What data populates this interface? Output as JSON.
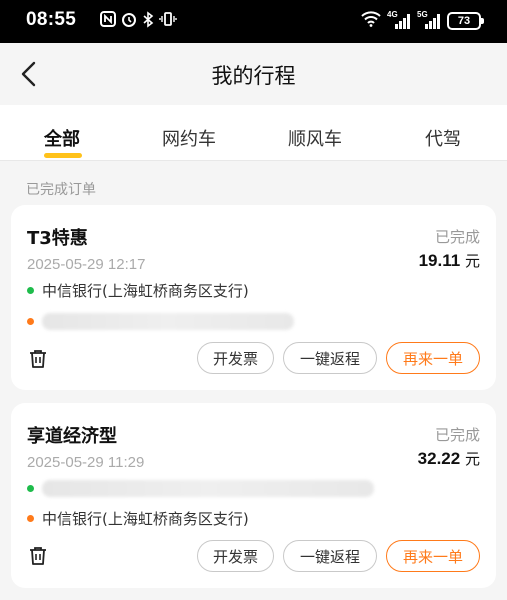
{
  "status_bar": {
    "time": "08:55",
    "battery": "73",
    "network_1": "4G",
    "network_2": "5G"
  },
  "header": {
    "title": "我的行程"
  },
  "tabs": [
    {
      "label": "全部",
      "active": true
    },
    {
      "label": "网约车",
      "active": false
    },
    {
      "label": "顺风车",
      "active": false
    },
    {
      "label": "代驾",
      "active": false
    }
  ],
  "section_label": "已完成订单",
  "orders": [
    {
      "service": "T3特惠",
      "status": "已完成",
      "time": "2025-05-29 12:17",
      "price": "19.11",
      "price_unit": "元",
      "pickup": "中信银行(上海虹桥商务区支行)",
      "actions": {
        "invoice": "开发票",
        "return_trip": "一键返程",
        "reorder": "再来一单"
      }
    },
    {
      "service": "享道经济型",
      "status": "已完成",
      "time": "2025-05-29 11:29",
      "price": "32.22",
      "price_unit": "元",
      "dropoff": "中信银行(上海虹桥商务区支行)",
      "actions": {
        "invoice": "开发票",
        "return_trip": "一键返程",
        "reorder": "再来一单"
      }
    }
  ],
  "colors": {
    "accent_yellow": "#ffc21a",
    "accent_orange": "#ff7a1a",
    "pickup_green": "#1ebc4b"
  }
}
